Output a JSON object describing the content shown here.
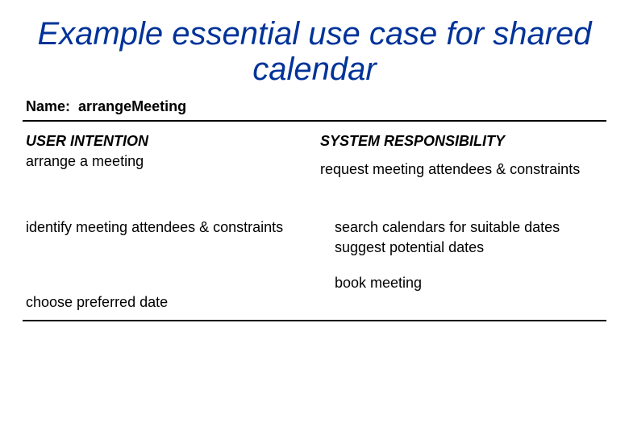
{
  "title": "Example essential use case for shared calendar",
  "name_label": "Name:",
  "name_value": "arrangeMeeting",
  "left": {
    "header": "USER INTENTION",
    "step1": "arrange a meeting",
    "step2": "identify meeting attendees & constraints",
    "step3": "choose preferred date"
  },
  "right": {
    "header": "SYSTEM RESPONSIBILITY",
    "step1": "request meeting attendees & constraints",
    "step2a": "search calendars for suitable dates",
    "step2b": "suggest potential dates",
    "step3": "book meeting"
  }
}
